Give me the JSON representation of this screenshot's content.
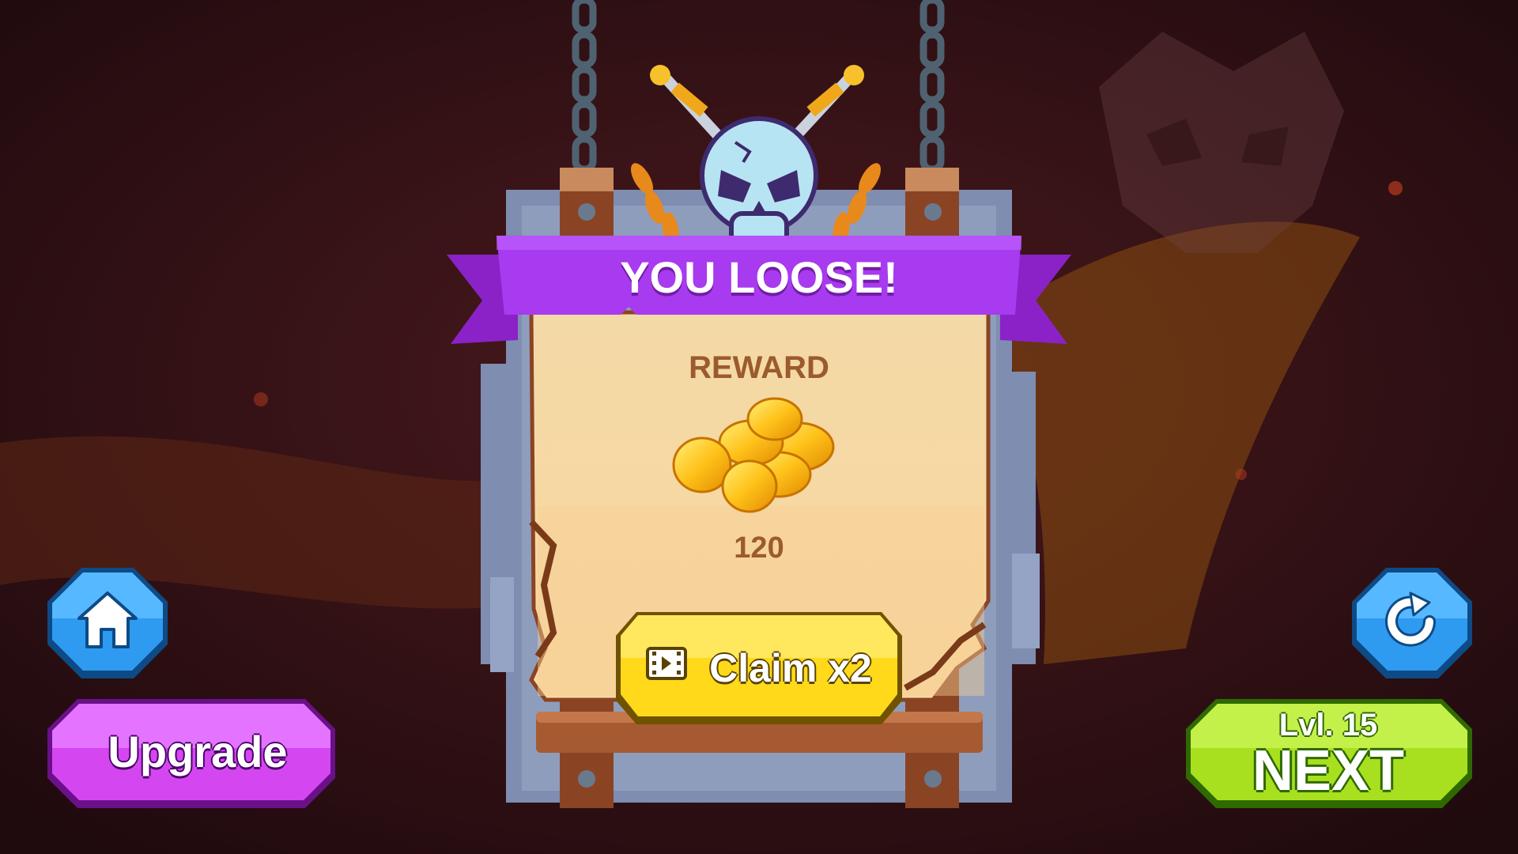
{
  "header": {
    "title": "YOU LOOSE!"
  },
  "reward": {
    "label": "REWARD",
    "amount": "120",
    "icon": "gold-coins-icon"
  },
  "buttons": {
    "claim_label": "Claim x2",
    "claim_icon": "video-ad-icon",
    "upgrade_label": "Upgrade",
    "home_icon": "home-icon",
    "restart_icon": "restart-icon",
    "level_label": "Lvl. 15",
    "next_label": "NEXT"
  },
  "colors": {
    "banner_purple": "#9b2fe0",
    "claim_yellow": "#ffd91a",
    "upgrade_magenta": "#d447f0",
    "next_green": "#a8e020",
    "icon_button_blue": "#2e9bf0"
  }
}
